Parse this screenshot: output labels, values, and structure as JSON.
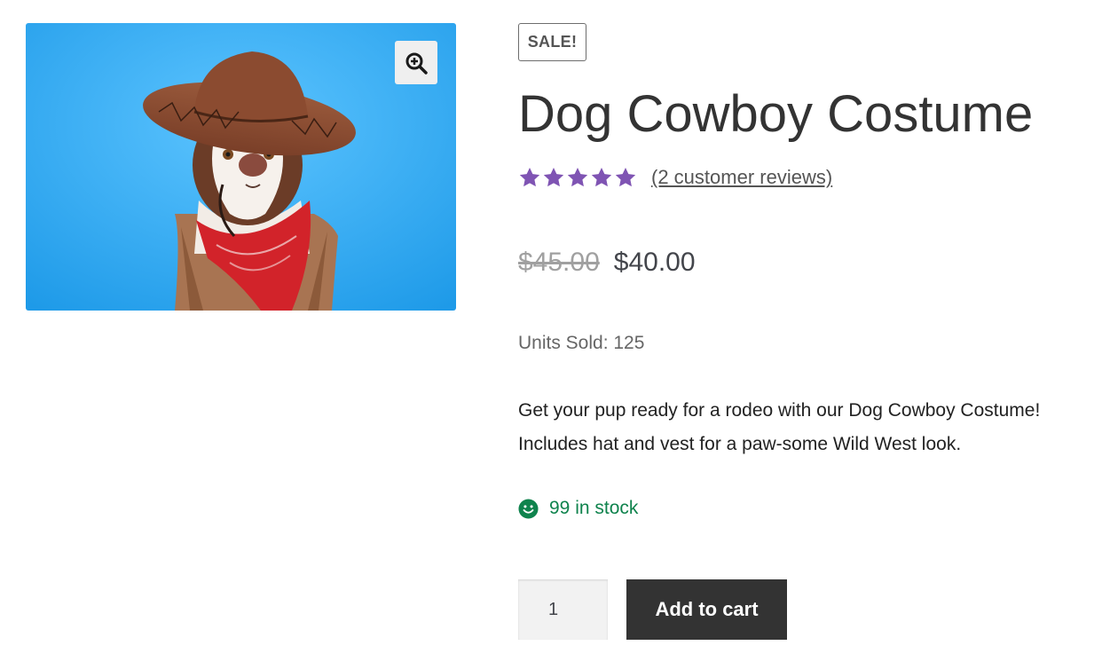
{
  "product": {
    "image_alt": "Husky dog wearing a brown cowboy hat, red bandana and fringed vest on a blue background",
    "sale_badge": "SALE!",
    "title": "Dog Cowboy Costume",
    "rating": {
      "stars_filled": 5,
      "stars_total": 5,
      "review_link": "(2 customer reviews)"
    },
    "price": {
      "original": "$45.00",
      "current": "$40.00"
    },
    "units_sold": "Units Sold: 125",
    "description": "Get your pup ready for a rodeo with our Dog Cowboy Costume! Includes hat and vest for a paw-some Wild West look.",
    "stock": "99 in stock",
    "quantity": "1",
    "add_to_cart_label": "Add to cart"
  },
  "colors": {
    "star": "#7f54b3",
    "stock": "#0f834d",
    "button_bg": "#333333",
    "image_bg": "#3fb0f5"
  },
  "icons": {
    "zoom": "zoom-in-magnifier-icon",
    "star": "star-icon",
    "stock": "smiley-icon"
  }
}
